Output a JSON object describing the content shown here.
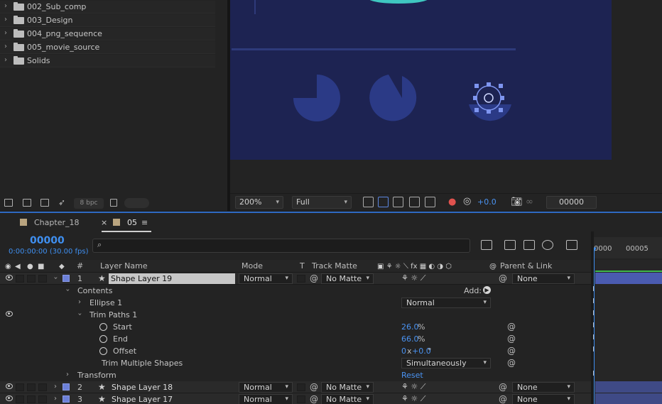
{
  "project": {
    "items": [
      {
        "label": "002_Sub_comp"
      },
      {
        "label": "003_Design"
      },
      {
        "label": "004_png_sequence"
      },
      {
        "label": "005_movie_source"
      },
      {
        "label": "Solids"
      }
    ],
    "bpc": "8 bpc"
  },
  "viewer": {
    "zoom": "200%",
    "resolution": "Full",
    "exposure": "+0.0",
    "timecode": "00000"
  },
  "timeline": {
    "tabs": [
      {
        "label": "Chapter_18"
      },
      {
        "label": "05"
      }
    ],
    "close_glyph": "×",
    "menu_glyph": "≡",
    "current_time": "00000",
    "current_time_sub": "0:00:00:00 (30.00 fps)",
    "search_placeholder": "",
    "ruler": [
      "0000",
      "00005"
    ],
    "columns": {
      "num": "#",
      "layer_name": "Layer Name",
      "mode": "Mode",
      "t": "T",
      "track_matte": "Track Matte",
      "parent": "Parent & Link"
    },
    "layers": [
      {
        "num": "1",
        "name": "Shape Layer 19",
        "mode": "Normal",
        "matte": "No Matte",
        "parent": "None"
      },
      {
        "num": "2",
        "name": "Shape Layer 18",
        "mode": "Normal",
        "matte": "No Matte",
        "parent": "None"
      },
      {
        "num": "3",
        "name": "Shape Layer 17",
        "mode": "Normal",
        "matte": "No Matte",
        "parent": "None"
      }
    ],
    "props": {
      "contents": "Contents",
      "add": "Add:",
      "ellipse": "Ellipse 1",
      "ellipse_mode": "Normal",
      "trim": "Trim Paths 1",
      "start": {
        "label": "Start",
        "value": "26.0",
        "unit": "%"
      },
      "end": {
        "label": "End",
        "value": "66.0",
        "unit": "%"
      },
      "offset": {
        "label": "Offset",
        "rev": "0",
        "x": "x",
        "deg": "+0.0",
        "unit": "°"
      },
      "multi": {
        "label": "Trim Multiple Shapes",
        "value": "Simultaneously"
      },
      "transform": "Transform",
      "reset": "Reset"
    }
  },
  "colors": {
    "accent": "#3f8ff0",
    "layer_label": "#6c80d8",
    "comp_bg": "#1d2352"
  },
  "icons": [
    "folder-icon",
    "chevron-right-icon",
    "eye-icon",
    "star-icon",
    "stopwatch-icon",
    "spiral-icon",
    "search-icon",
    "camera-icon"
  ]
}
